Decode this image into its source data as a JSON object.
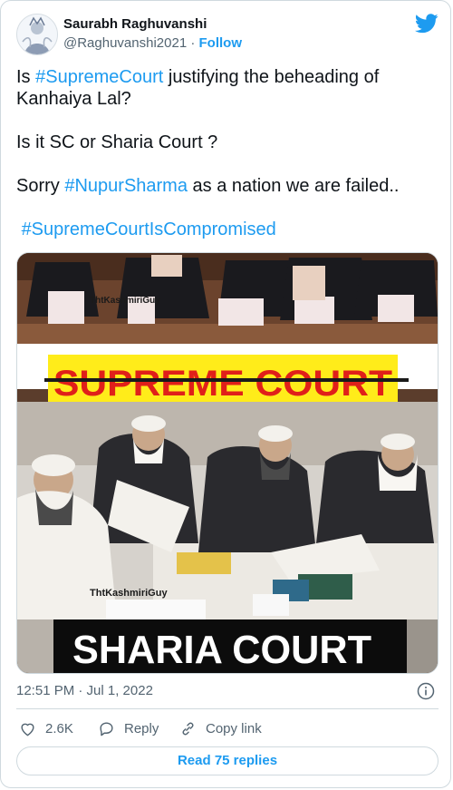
{
  "author": {
    "name": "Saurabh Raghuvanshi",
    "handle": "@Raghuvanshi2021",
    "separator": "·",
    "follow_label": "Follow"
  },
  "tweet": {
    "line1_prefix": "Is ",
    "line1_tag": "#SupremeCourt",
    "line1_suffix": " justifying the beheading of Kanhaiya Lal?",
    "line2": "Is it SC or Sharia Court ?",
    "line3_prefix": "Sorry ",
    "line3_tag": "#NupurSharma",
    "line3_suffix": " as a nation we are failed..",
    "line4_tag": "#SupremeCourtIsCompromised"
  },
  "media": {
    "watermark_top": "ThtKashmiriGuy",
    "banner_top": "SUPREME COURT",
    "watermark_bottom": "ThtKashmiriGuy",
    "banner_bottom": "SHARIA COURT"
  },
  "meta": {
    "timestamp": "12:51 PM · Jul 1, 2022"
  },
  "actions": {
    "like_count": "2.6K",
    "reply_label": "Reply",
    "copy_label": "Copy link"
  },
  "read_replies_label": "Read 75 replies",
  "colors": {
    "accent": "#1d9bf0",
    "muted": "#536471",
    "banner_yellow": "#ffec1a",
    "banner_red": "#e0201a"
  }
}
